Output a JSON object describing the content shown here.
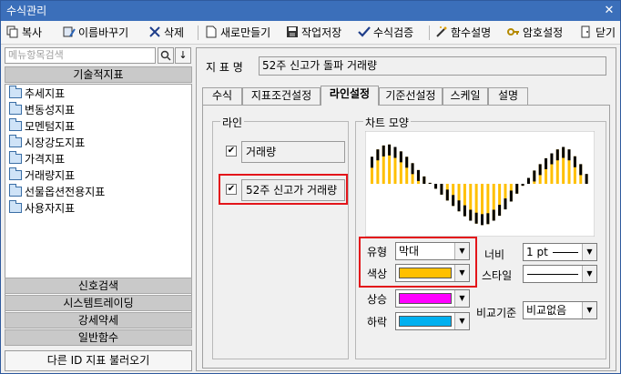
{
  "window": {
    "title": "수식관리",
    "close_glyph": "✕"
  },
  "toolbar": [
    {
      "label": "복사",
      "icon": "copy-icon"
    },
    {
      "label": "이름바꾸기",
      "icon": "rename-icon"
    },
    {
      "label": "삭제",
      "icon": "delete-icon"
    },
    {
      "label": "새로만들기",
      "icon": "new-document-icon"
    },
    {
      "label": "작업저장",
      "icon": "save-icon"
    },
    {
      "label": "수식검증",
      "icon": "check-icon"
    },
    {
      "label": "함수설명",
      "icon": "magic-wand-icon"
    },
    {
      "label": "암호설정",
      "icon": "key-icon"
    },
    {
      "label": "닫기",
      "icon": "close-door-icon"
    }
  ],
  "left": {
    "search_placeholder": "메뉴항목검색",
    "search_btn": "🔍",
    "down_btn": "↓",
    "category_header": "기술적지표",
    "tree_items": [
      "추세지표",
      "변동성지표",
      "모멘텀지표",
      "시장강도지표",
      "가격지표",
      "거래량지표",
      "선물옵션전용지표",
      "사용자지표"
    ],
    "sections": [
      "신호검색",
      "시스템트레이딩",
      "강세약세",
      "일반함수"
    ],
    "load_button": "다른 ID 지표 불러오기"
  },
  "right": {
    "name_label": "지 표 명",
    "name_value": "52주 신고가 돌파 거래량",
    "tabs": [
      "수식",
      "지표조건설정",
      "라인설정",
      "기준선설정",
      "스케일",
      "설명"
    ],
    "active_tab": "라인설정",
    "line_group": {
      "title": "라인",
      "items": [
        {
          "label": "거래량",
          "checked": true
        },
        {
          "label": "52주 신고가 거래량",
          "checked": true
        }
      ]
    },
    "chart_group": {
      "title": "차트 모양",
      "type_label": "유형",
      "type_value": "막대",
      "color_label": "색상",
      "color_value": "#ffc000",
      "up_label": "상승",
      "up_color": "#ff00ff",
      "down_label": "하락",
      "down_color": "#00b0f0",
      "width_label": "너비",
      "width_value": "1 pt",
      "style_label": "스타일",
      "compare_label": "비교기준",
      "compare_value": "비교없음"
    }
  },
  "chart_data": {
    "type": "bar",
    "bar_color": "#ffc000",
    "cap_color": "#000000",
    "values": [
      0.55,
      0.7,
      0.78,
      0.8,
      0.75,
      0.66,
      0.55,
      0.42,
      0.28,
      0.15,
      0.02,
      -0.1,
      -0.22,
      -0.34,
      -0.45,
      -0.56,
      -0.66,
      -0.75,
      -0.81,
      -0.84,
      -0.82,
      -0.75,
      -0.65,
      -0.52,
      -0.36,
      -0.2,
      -0.04,
      0.12,
      0.27,
      0.4,
      0.52,
      0.62,
      0.7,
      0.75,
      0.7,
      0.56,
      0.4,
      0.2
    ]
  }
}
